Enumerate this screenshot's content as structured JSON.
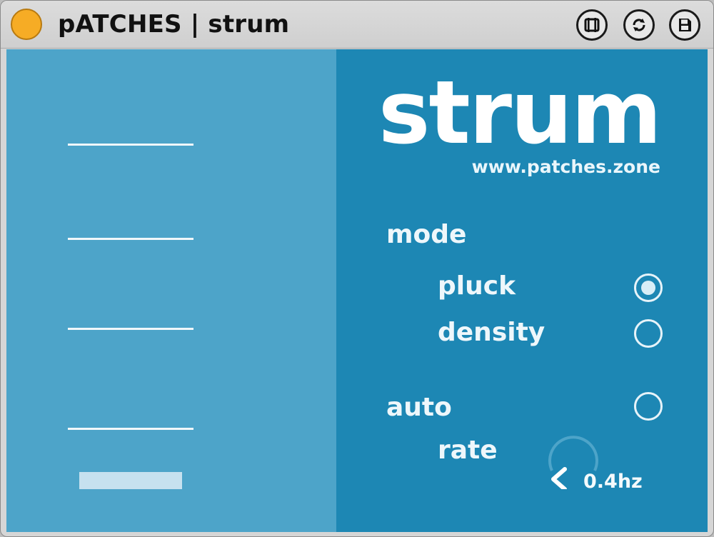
{
  "window": {
    "title": "pATCHES | strum"
  },
  "device": {
    "logo": "strum",
    "url": "www.patches.zone",
    "mode": {
      "label": "mode",
      "options": [
        {
          "label": "pluck",
          "selected": true
        },
        {
          "label": "density",
          "selected": false
        }
      ]
    },
    "auto": {
      "label": "auto",
      "enabled": false
    },
    "rate": {
      "label": "rate",
      "value_text": "0.4hz"
    }
  },
  "colors": {
    "left_panel": "#4da4c9",
    "right_panel": "#1d87b4",
    "status_dot": "#f6ac25"
  },
  "icons": [
    "status-dot-icon",
    "film-icon",
    "refresh-icon",
    "save-icon",
    "radio-icon",
    "dial-icon"
  ]
}
